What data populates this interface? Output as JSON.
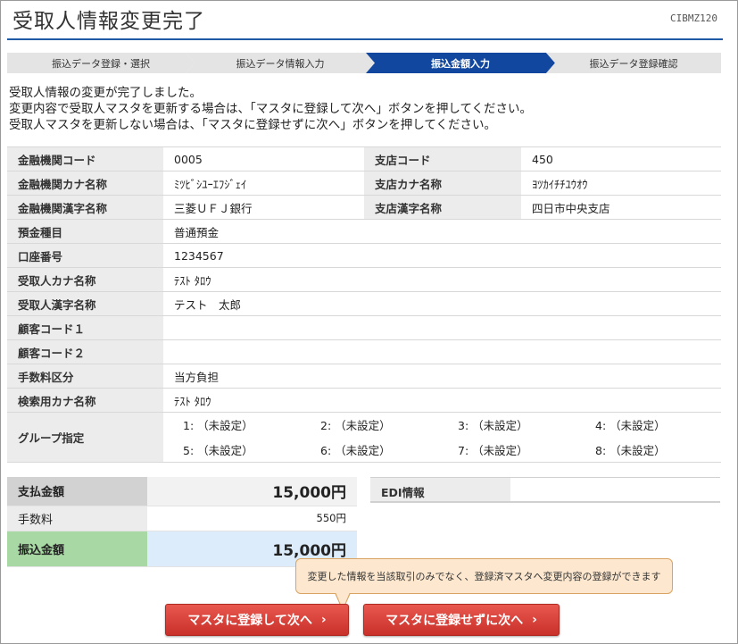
{
  "header": {
    "title": "受取人情報変更完了",
    "screen_id": "CIBMZ120"
  },
  "steps": [
    "振込データ登録・選択",
    "振込データ情報入力",
    "振込金額入力",
    "振込データ登録確認"
  ],
  "messages": [
    "受取人情報の変更が完了しました。",
    "変更内容で受取人マスタを更新する場合は、「マスタに登録して次へ」ボタンを押してください。",
    "受取人マスタを更新しない場合は、「マスタに登録せずに次へ」ボタンを押してください。"
  ],
  "info": {
    "bank_code_label": "金融機関コード",
    "bank_code": "0005",
    "branch_code_label": "支店コード",
    "branch_code": "450",
    "bank_kana_label": "金融機関カナ名称",
    "bank_kana": "ﾐﾂﾋﾞｼﾕｰｴﾌｼﾞｪｲ",
    "branch_kana_label": "支店カナ名称",
    "branch_kana": "ﾖﾂｶｲﾁﾁﾕｳｵｳ",
    "bank_kanji_label": "金融機関漢字名称",
    "bank_kanji": "三菱ＵＦＪ銀行",
    "branch_kanji_label": "支店漢字名称",
    "branch_kanji": "四日市中央支店",
    "deposit_type_label": "預金種目",
    "deposit_type": "普通預金",
    "account_no_label": "口座番号",
    "account_no": "1234567",
    "payee_kana_label": "受取人カナ名称",
    "payee_kana": "ﾃｽﾄ ﾀﾛｳ",
    "payee_kanji_label": "受取人漢字名称",
    "payee_kanji": "テスト　太郎",
    "customer_code1_label": "顧客コード１",
    "customer_code1": "",
    "customer_code2_label": "顧客コード２",
    "customer_code2": "",
    "fee_type_label": "手数料区分",
    "fee_type": "当方負担",
    "search_kana_label": "検索用カナ名称",
    "search_kana": "ﾃｽﾄ ﾀﾛｳ",
    "group_label": "グループ指定",
    "groups": [
      "1: （未設定）",
      "2: （未設定）",
      "3: （未設定）",
      "4: （未設定）",
      "5: （未設定）",
      "6: （未設定）",
      "7: （未設定）",
      "8: （未設定）"
    ]
  },
  "amounts": {
    "payment_label": "支払金額",
    "payment": "15,000円",
    "fee_label": "手数料",
    "fee": "550円",
    "transfer_label": "振込金額",
    "transfer": "15,000円"
  },
  "edi": {
    "label": "EDI情報",
    "value": ""
  },
  "callout": {
    "text": "変更した情報を当該取引のみでなく、登録済マスタへ変更内容の登録ができます"
  },
  "buttons": {
    "register": "マスタに登録して次へ",
    "no_register": "マスタに登録せずに次へ",
    "chevron": "›"
  },
  "colors": {
    "accent": "#1f5aa6",
    "active_step": "#11479e",
    "button": "#d9413a",
    "transfer_label_bg": "#a8d8a3",
    "transfer_value_bg": "#ddecfb",
    "callout_bg": "#fde8cf"
  }
}
